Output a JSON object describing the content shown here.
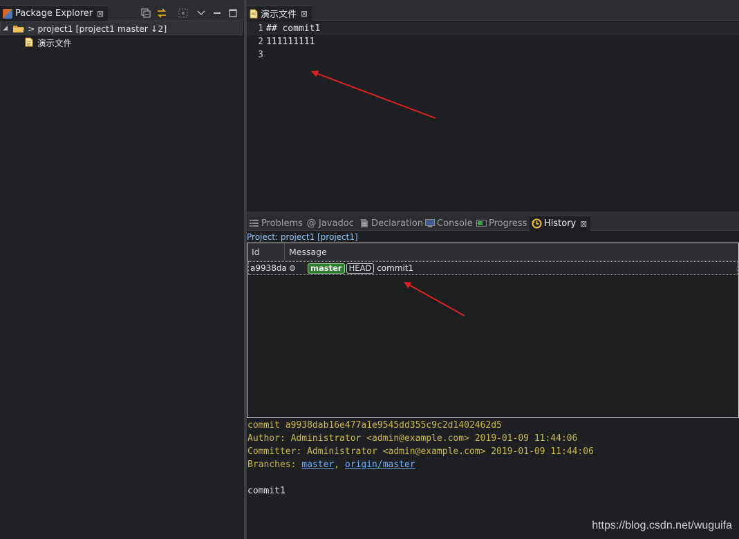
{
  "package_explorer": {
    "tab_label": "Package Explorer",
    "project_row": "> project1 [project1 master ↓2]",
    "file_row": "演示文件"
  },
  "editor": {
    "tab_label": "演示文件",
    "lines": [
      {
        "no": "1",
        "text": "## commit1"
      },
      {
        "no": "2",
        "text": "111111111"
      },
      {
        "no": "3",
        "text": ""
      }
    ]
  },
  "bottom_tabs": {
    "problems": "Problems",
    "javadoc": "Javadoc",
    "declaration": "Declaration",
    "console": "Console",
    "progress": "Progress",
    "history": "History"
  },
  "history": {
    "project_label": "Project: project1 [project1]",
    "columns": {
      "id": "Id",
      "message": "Message"
    },
    "row": {
      "id": "a9938da",
      "refs": [
        "master",
        "HEAD"
      ],
      "message": "commit1"
    },
    "details": {
      "commit": "commit a9938dab16e477a1e9545dd355c9c2d1402462d5",
      "author": "Author: Administrator <admin@example.com> 2019-01-09 11:44:06",
      "committer": "Committer: Administrator <admin@example.com> 2019-01-09 11:44:06",
      "branches_label": "Branches: ",
      "branch_1": "master",
      "branch_sep": ", ",
      "branch_2": "origin/master",
      "message": "commit1"
    }
  },
  "watermark": "https://blog.csdn.net/wuguifa",
  "colors": {
    "background": "#1e1f22",
    "annotation_arrow": "#e02020",
    "master_badge": "#2f7d2f",
    "detail_text": "#c9b94a",
    "link": "#6cb0ff"
  }
}
